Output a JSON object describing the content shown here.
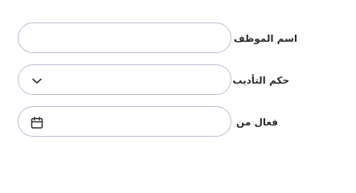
{
  "form": {
    "fields": [
      {
        "label": "اسم الموظف",
        "value": "",
        "type": "text"
      },
      {
        "label": "حكم التأديب",
        "value": "",
        "type": "select",
        "icon": "chevron-down-icon"
      },
      {
        "label": "فعال من",
        "value": "",
        "type": "date",
        "icon": "calendar-icon"
      }
    ]
  },
  "colors": {
    "border": "#b9bed3",
    "label": "#2d2d2d",
    "icon": "#2d2d2d"
  }
}
